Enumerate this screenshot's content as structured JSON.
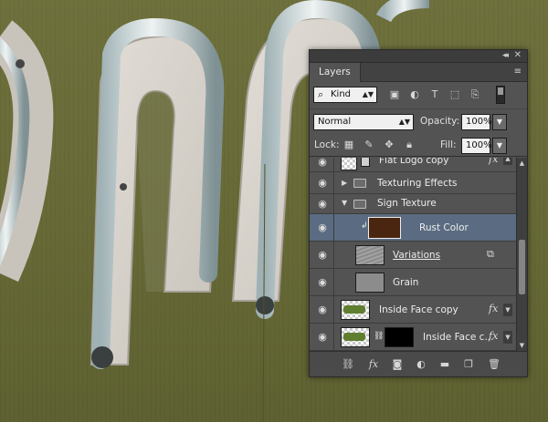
{
  "panel": {
    "collapse_glyph": "◂◂",
    "close_glyph": "✕",
    "tab_label": "Layers",
    "menu_glyph": "≡"
  },
  "filter": {
    "kind_label": "Kind",
    "search_glyph": "⌕",
    "icons": [
      "image-filter-icon",
      "adjustment-filter-icon",
      "type-filter-icon",
      "shape-filter-icon",
      "smart-object-filter-icon"
    ]
  },
  "blend": {
    "mode": "Normal",
    "opacity_label": "Opacity:",
    "opacity_value": "100%"
  },
  "lock": {
    "label": "Lock:",
    "fill_label": "Fill:",
    "fill_value": "100%"
  },
  "layers": [
    {
      "name": "Flat Logo copy",
      "type": "layer",
      "fx": "fx"
    },
    {
      "name": "Texturing Effects",
      "type": "group-collapsed"
    },
    {
      "name": "Sign Texture",
      "type": "group-expanded"
    },
    {
      "name": "Rust Color",
      "type": "fill",
      "selected": true,
      "color": "#4a2510"
    },
    {
      "name": "Variations",
      "type": "layer"
    },
    {
      "name": "Grain",
      "type": "layer"
    },
    {
      "name": "Inside Face copy",
      "type": "layer",
      "fx": "fx"
    },
    {
      "name": "Inside Face c...",
      "type": "layer",
      "fx": "fx"
    }
  ],
  "bottom_icons": [
    "link-layers-icon",
    "fx-icon",
    "mask-icon",
    "adjustment-layer-icon",
    "new-group-icon",
    "new-layer-icon",
    "trash-icon"
  ],
  "bottom_fx_label": "fx",
  "colors": {
    "panel_bg": "#535353",
    "selected_row": "#5b6c82",
    "canvas_green": "#6b6d3a",
    "sign_face": "#d7d3cc"
  }
}
